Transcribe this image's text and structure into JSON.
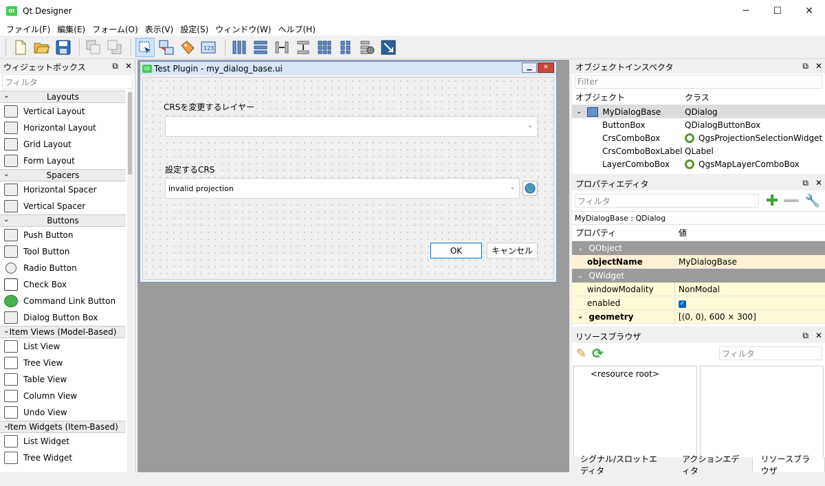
{
  "window": {
    "title": "Qt Designer",
    "app_icon": "Qt",
    "controls": [
      "─",
      "☐",
      "✕"
    ]
  },
  "menubar": [
    "ファイル(F)",
    "編集(E)",
    "フォーム(O)",
    "表示(V)",
    "設定(S)",
    "ウィンドウ(W)",
    "ヘルプ(H)"
  ],
  "toolbar": {
    "icons": [
      "new-file-icon",
      "open-file-icon",
      "save-icon",
      "send-to-back-icon",
      "bring-to-front-icon",
      "edit-widgets-icon",
      "edit-signals-slots-icon",
      "edit-buddies-icon",
      "edit-tab-order-icon",
      "layout-horizontal-icon",
      "layout-vertical-icon",
      "layout-horizontal-splitter-icon",
      "layout-vertical-splitter-icon",
      "layout-grid-icon",
      "layout-form-icon",
      "break-layout-icon",
      "adjust-size-icon"
    ],
    "active_index": 5
  },
  "widgetbox": {
    "title": "ウィジェットボックス",
    "filter_placeholder": "フィルタ",
    "categories": [
      {
        "name": "Layouts",
        "items": [
          "Vertical Layout",
          "Horizontal Layout",
          "Grid Layout",
          "Form Layout"
        ]
      },
      {
        "name": "Spacers",
        "items": [
          "Horizontal Spacer",
          "Vertical Spacer"
        ]
      },
      {
        "name": "Buttons",
        "items": [
          "Push Button",
          "Tool Button",
          "Radio Button",
          "Check Box",
          "Command Link Button",
          "Dialog Button Box"
        ]
      },
      {
        "name": "Item Views (Model-Based)",
        "items": [
          "List View",
          "Tree View",
          "Table View",
          "Column View",
          "Undo View"
        ]
      },
      {
        "name": "Item Widgets (Item-Based)",
        "items": [
          "List Widget",
          "Tree Widget"
        ]
      }
    ]
  },
  "form": {
    "title": "Test Plugin - my_dialog_base.ui",
    "label1": "CRSを変更するレイヤー",
    "combo1_value": "",
    "label2": "設定するCRS",
    "combo2_value": "invalid projection",
    "ok": "OK",
    "cancel": "キャンセル"
  },
  "object_inspector": {
    "title": "オブジェクトインスペクタ",
    "filter_placeholder": "Filter",
    "col_object": "オブジェクト",
    "col_class": "クラス",
    "rows": [
      {
        "object": "MyDialogBase",
        "class": "QDialog",
        "qgis": false
      },
      {
        "object": "ButtonBox",
        "class": "QDialogButtonBox",
        "qgis": false
      },
      {
        "object": "CrsComboBox",
        "class": "QgsProjectionSelectionWidget",
        "qgis": true
      },
      {
        "object": "CrsComboBoxLabel",
        "class": "QLabel",
        "qgis": false
      },
      {
        "object": "LayerComboBox",
        "class": "QgsMapLayerComboBox",
        "qgis": true
      }
    ]
  },
  "property_editor": {
    "title": "プロパティエディタ",
    "filter_placeholder": "フィルタ",
    "context": "MyDialogBase : QDialog",
    "col_property": "プロパティ",
    "col_value": "値",
    "group1": "QObject",
    "objectName_label": "objectName",
    "objectName_value": "MyDialogBase",
    "group2": "QWidget",
    "windowModality_label": "windowModality",
    "windowModality_value": "NonModal",
    "enabled_label": "enabled",
    "enabled_value": true,
    "geometry_label": "geometry",
    "geometry_value": "[(0, 0), 600 × 300]"
  },
  "resource_browser": {
    "title": "リソースブラウザ",
    "filter_placeholder": "フィルタ",
    "root": "<resource root>"
  },
  "bottom_tabs": [
    "シグナル/スロットエディタ",
    "アクションエディタ",
    "リソースブラウザ"
  ],
  "active_tab": 2
}
